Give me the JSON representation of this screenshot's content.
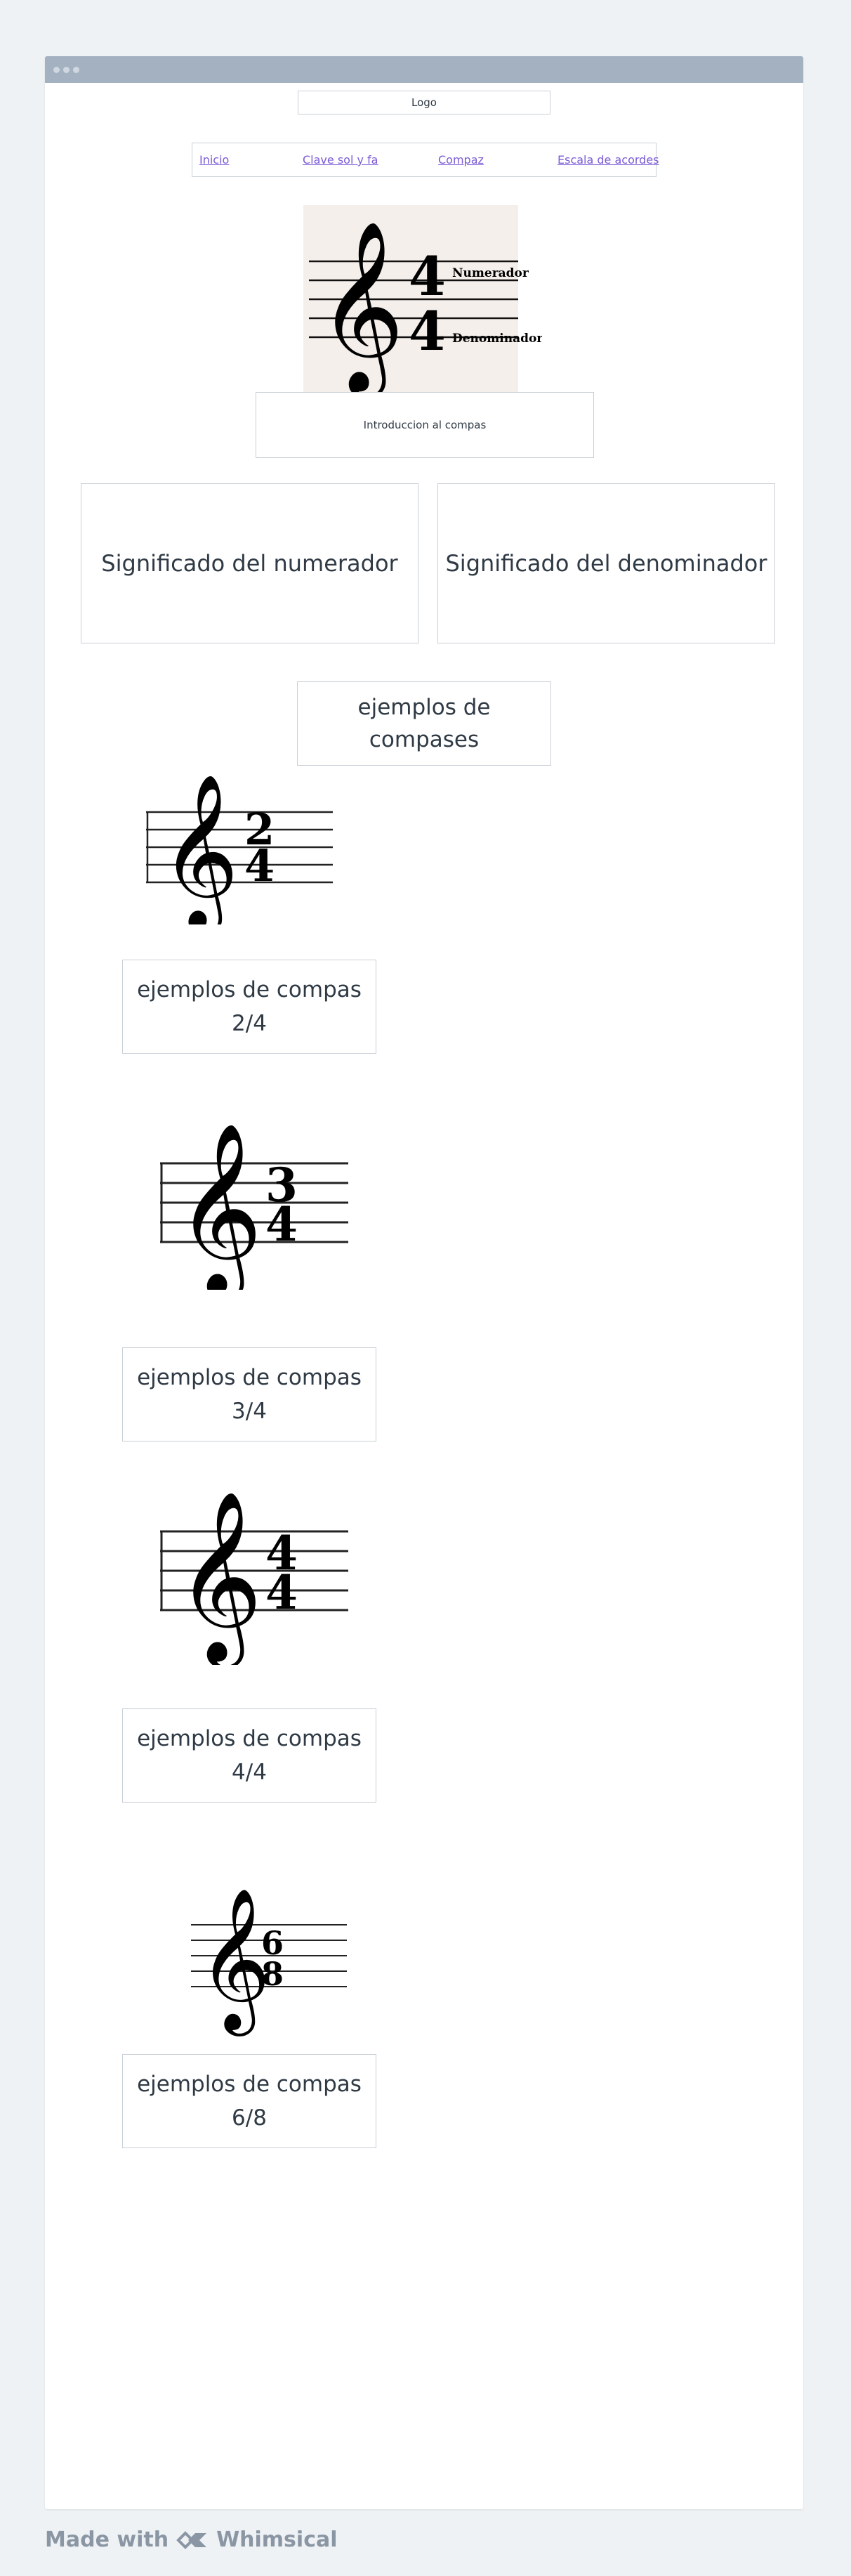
{
  "header": {
    "logo_label": "Logo"
  },
  "nav": {
    "items": [
      "Inicio",
      "Clave sol y fa",
      "Compaz",
      "Escala de acordes"
    ]
  },
  "hero": {
    "time_signature": {
      "top": "4",
      "bottom": "4"
    },
    "numerator_label": "Numerador",
    "denominator_label": "Denominador",
    "intro_label": "Introduccion al compas"
  },
  "meaning": {
    "numerator_label": "Significado del numerador",
    "denominator_label": "Significado del denominador"
  },
  "examples": {
    "heading_line1": "ejemplos de",
    "heading_line2": "compases",
    "items": [
      {
        "caption_line1": "ejemplos de compas",
        "caption_line2": "2/4",
        "top": "2",
        "bottom": "4"
      },
      {
        "caption_line1": "ejemplos de compas",
        "caption_line2": "3/4",
        "top": "3",
        "bottom": "4"
      },
      {
        "caption_line1": "ejemplos de compas",
        "caption_line2": "4/4",
        "top": "4",
        "bottom": "4"
      },
      {
        "caption_line1": "ejemplos de compas",
        "caption_line2": "6/8",
        "top": "6",
        "bottom": "8"
      }
    ]
  },
  "footer": {
    "made_with": "Made with",
    "brand": "Whimsical"
  },
  "colors": {
    "link": "#7b5bd6",
    "titlebar": "#a3b1c0",
    "border": "#c8cfd6",
    "background": "#eff2f5"
  }
}
